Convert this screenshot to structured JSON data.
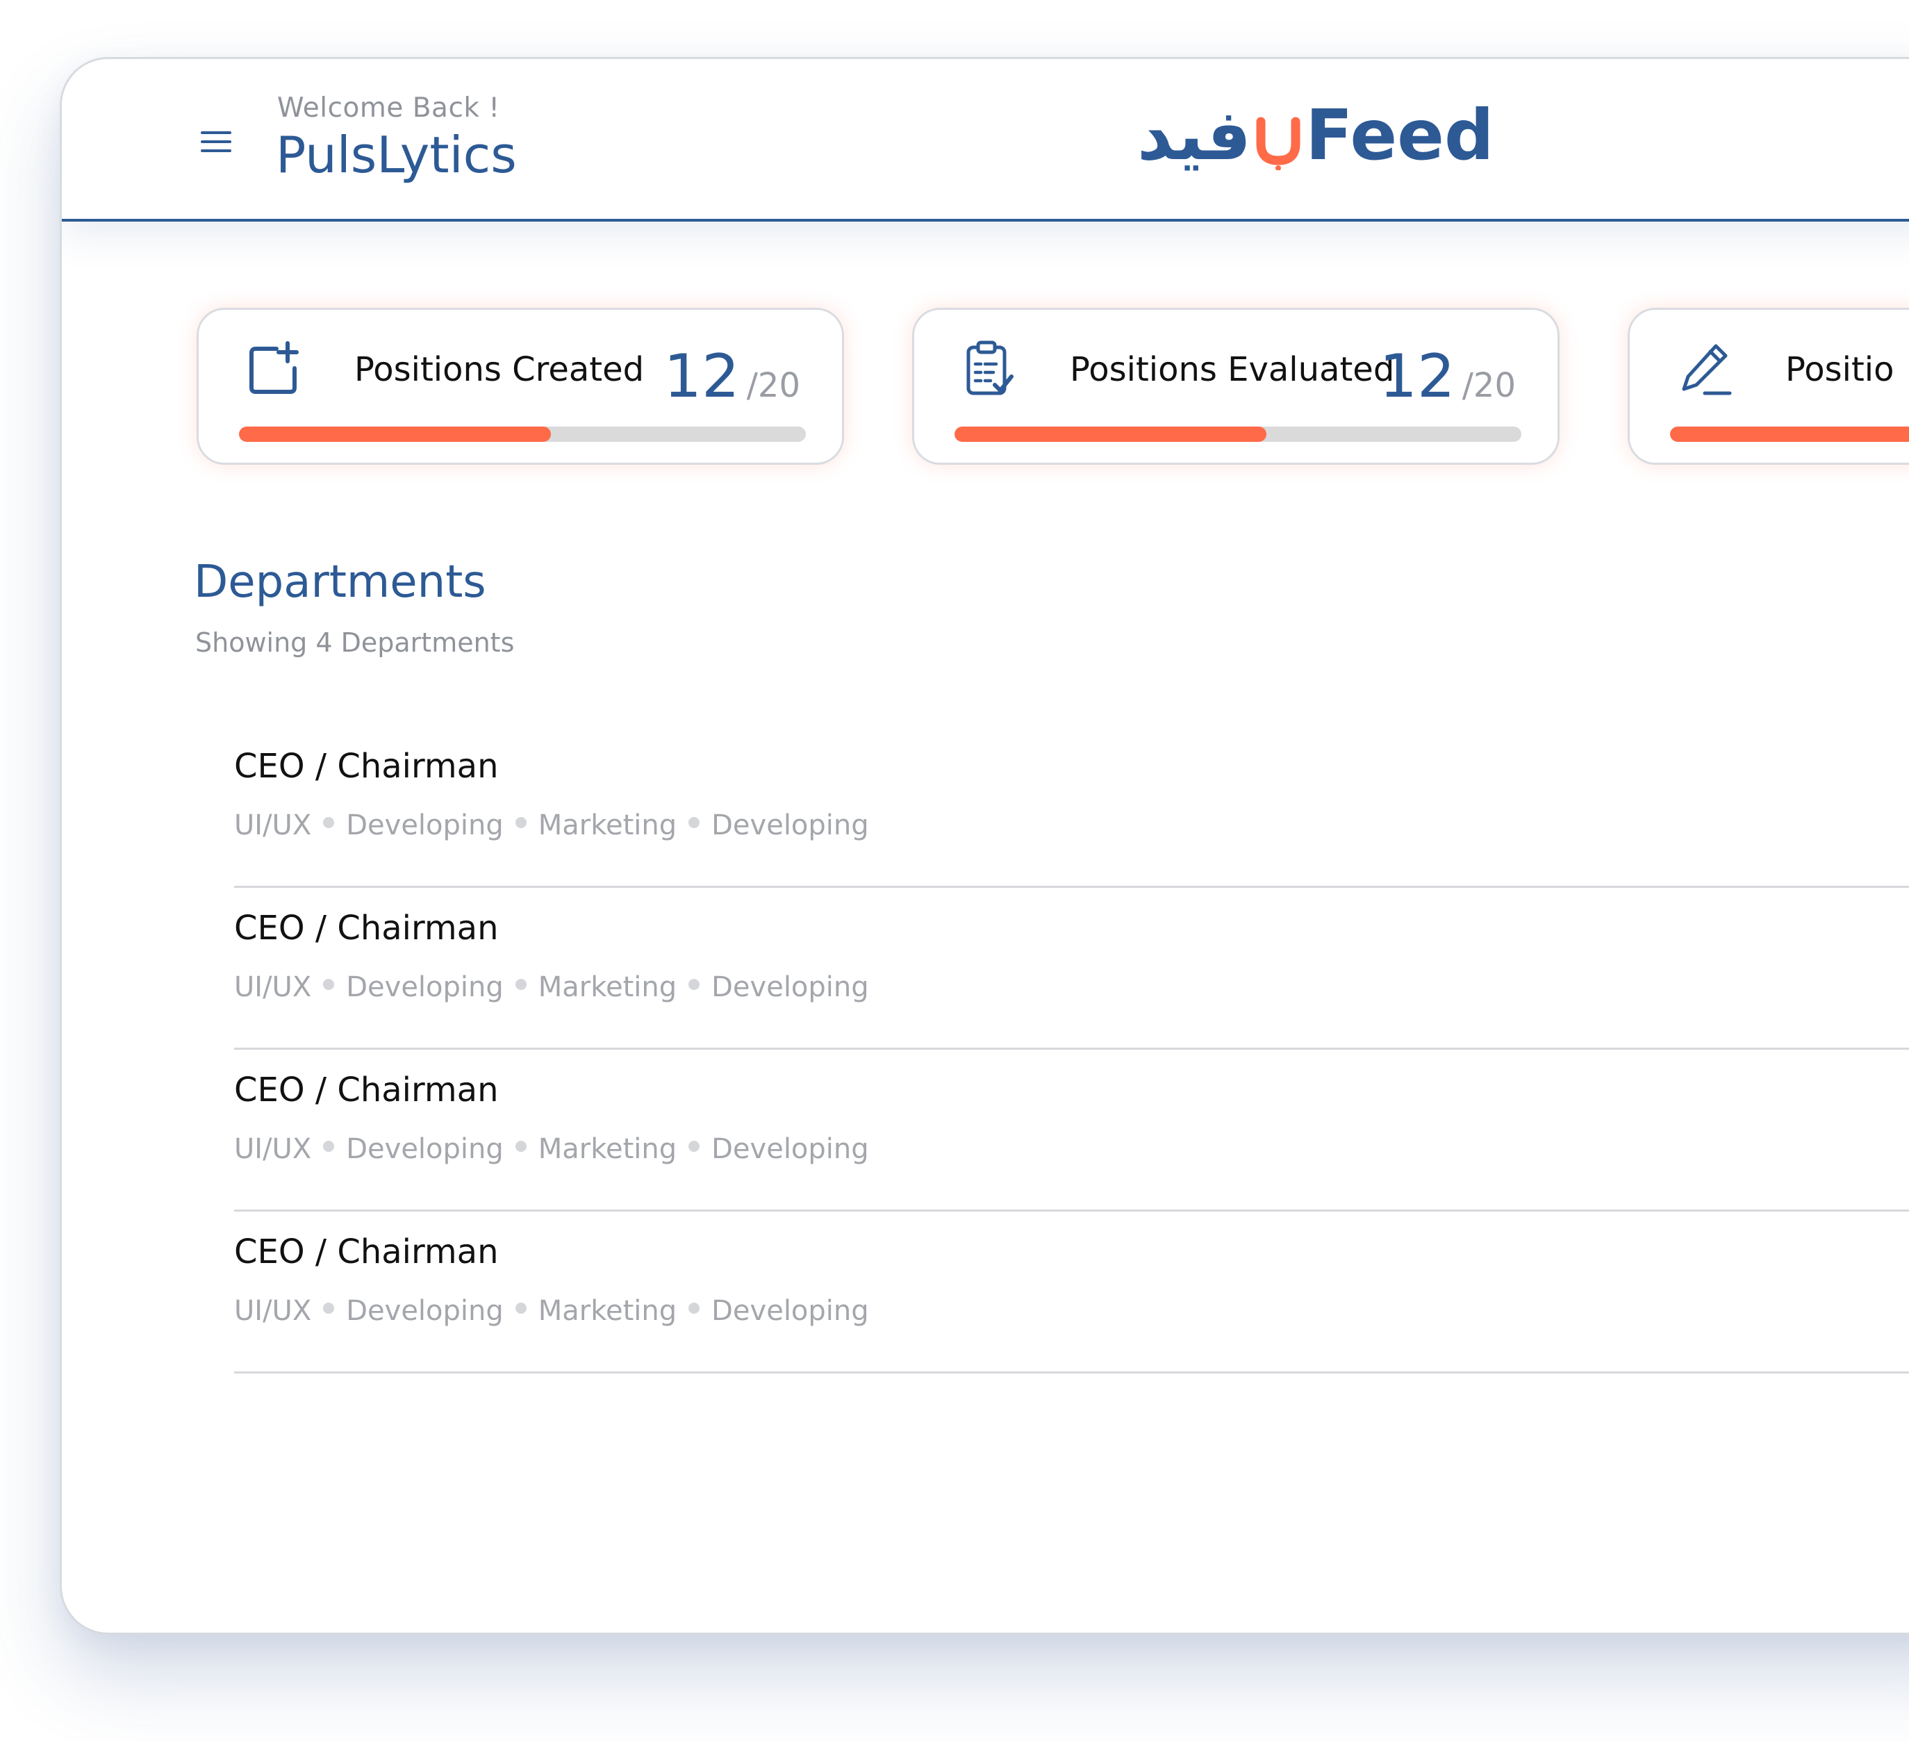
{
  "header": {
    "welcome": "Welcome Back !",
    "brand_title": "PulsLytics",
    "logo_arabic": "فيد",
    "logo_english": "Feed",
    "menu_icon": "hamburger-menu-icon"
  },
  "stats": [
    {
      "icon": "add-position-icon",
      "label": "Positions Created",
      "value": "12",
      "total": "/20",
      "progress": 0.55
    },
    {
      "icon": "clipboard-check-icon",
      "label": "Positions Evaluated",
      "value": "12",
      "total": "/20",
      "progress": 0.55
    },
    {
      "icon": "pencil-icon",
      "label": "Positio",
      "value": "",
      "total": "",
      "progress": 0.55
    }
  ],
  "departments": {
    "title": "Departments",
    "subtitle": "Showing 4 Departments",
    "items": [
      {
        "name": "CEO / Chairman",
        "tags": [
          "UI/UX",
          "Developing",
          "Marketing",
          "Developing"
        ]
      },
      {
        "name": "CEO / Chairman",
        "tags": [
          "UI/UX",
          "Developing",
          "Marketing",
          "Developing"
        ]
      },
      {
        "name": "CEO / Chairman",
        "tags": [
          "UI/UX",
          "Developing",
          "Marketing",
          "Developing"
        ]
      },
      {
        "name": "CEO / Chairman",
        "tags": [
          "UI/UX",
          "Developing",
          "Marketing",
          "Developing"
        ]
      }
    ]
  },
  "colors": {
    "brand_blue": "#2d5a95",
    "accent_orange": "#ff6a48",
    "track_gray": "#dadada"
  }
}
